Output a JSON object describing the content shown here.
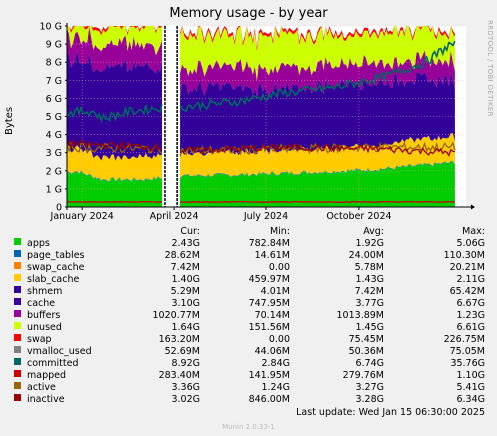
{
  "chart_data": {
    "type": "area",
    "title": "Memory usage - by year",
    "ylabel": "Bytes",
    "xlabel": "",
    "side_label": "RRDTOOL / TOBI OETIKER",
    "y_tick_labels": [
      "0",
      "1 G",
      "2 G",
      "3 G",
      "4 G",
      "5 G",
      "6 G",
      "7 G",
      "8 G",
      "9 G",
      "10 G"
    ],
    "ylim": [
      0,
      10
    ],
    "ylim_unit": "GB",
    "x_tick_labels": [
      "January 2024",
      "April 2024",
      "July 2024",
      "October 2024"
    ],
    "x_ticks": [
      0,
      91,
      182,
      274
    ],
    "xlim": [
      -15,
      380
    ],
    "xlim_unit": "days since 2024-01-01",
    "gap": [
      80,
      96
    ],
    "grid": true,
    "stacked_series": [
      {
        "name": "apps",
        "color": "#00cc00",
        "points": [
          [
            -15,
            1.9
          ],
          [
            -5,
            1.95
          ],
          [
            20,
            1.5
          ],
          [
            60,
            1.5
          ],
          [
            80,
            1.6
          ],
          [
            96,
            1.7
          ],
          [
            150,
            1.75
          ],
          [
            200,
            1.85
          ],
          [
            250,
            1.95
          ],
          [
            300,
            2.1
          ],
          [
            340,
            2.3
          ],
          [
            370,
            2.45
          ]
        ]
      },
      {
        "name": "page_tables",
        "color": "#0066b3",
        "points": [
          [
            -15,
            0.03
          ],
          [
            370,
            0.03
          ]
        ]
      },
      {
        "name": "swap_cache",
        "color": "#ff8000",
        "points": [
          [
            -15,
            0.01
          ],
          [
            370,
            0.01
          ]
        ]
      },
      {
        "name": "slab_cache",
        "color": "#ffcc00",
        "points": [
          [
            -15,
            1.3
          ],
          [
            20,
            1.2
          ],
          [
            80,
            1.3
          ],
          [
            96,
            1.2
          ],
          [
            200,
            1.25
          ],
          [
            300,
            1.35
          ],
          [
            370,
            1.4
          ]
        ]
      },
      {
        "name": "shmem",
        "color": "#330099",
        "points": [
          [
            -15,
            0.01
          ],
          [
            370,
            0.01
          ]
        ]
      },
      {
        "name": "cache",
        "color": "#330099",
        "points": [
          [
            -15,
            5.0
          ],
          [
            20,
            5.0
          ],
          [
            80,
            4.9
          ],
          [
            96,
            3.6
          ],
          [
            150,
            3.6
          ],
          [
            200,
            3.3
          ],
          [
            260,
            3.6
          ],
          [
            320,
            3.4
          ],
          [
            370,
            3.1
          ]
        ]
      },
      {
        "name": "buffers",
        "color": "#990099",
        "points": [
          [
            -15,
            1.3
          ],
          [
            80,
            1.2
          ],
          [
            96,
            1.1
          ],
          [
            200,
            1.15
          ],
          [
            300,
            1.1
          ],
          [
            370,
            1.0
          ]
        ]
      },
      {
        "name": "unused",
        "color": "#ccff00",
        "points": [
          [
            -15,
            0.85
          ],
          [
            20,
            1.0
          ],
          [
            80,
            1.2
          ],
          [
            96,
            1.85
          ],
          [
            150,
            1.7
          ],
          [
            200,
            1.9
          ],
          [
            260,
            1.55
          ],
          [
            320,
            1.7
          ],
          [
            370,
            1.63
          ]
        ]
      },
      {
        "name": "swap",
        "color": "#ff0000",
        "points": [
          [
            -15,
            0.16
          ],
          [
            370,
            0.16
          ]
        ]
      }
    ],
    "line_series": [
      {
        "name": "committed",
        "color": "#006666",
        "points": [
          [
            -15,
            5.2
          ],
          [
            10,
            5.3
          ],
          [
            20,
            4.9
          ],
          [
            50,
            5.3
          ],
          [
            80,
            5.5
          ],
          [
            96,
            5.5
          ],
          [
            150,
            5.8
          ],
          [
            200,
            6.3
          ],
          [
            250,
            6.6
          ],
          [
            300,
            7.2
          ],
          [
            340,
            8.0
          ],
          [
            365,
            9.0
          ],
          [
            370,
            8.9
          ]
        ]
      },
      {
        "name": "active",
        "color": "#996600",
        "points": [
          [
            -15,
            3.3
          ],
          [
            80,
            3.2
          ],
          [
            96,
            3.1
          ],
          [
            200,
            3.2
          ],
          [
            300,
            3.3
          ],
          [
            370,
            3.3
          ]
        ]
      },
      {
        "name": "inactive",
        "color": "#990000",
        "points": [
          [
            -15,
            3.5
          ],
          [
            80,
            3.3
          ],
          [
            96,
            3.1
          ],
          [
            200,
            3.3
          ],
          [
            300,
            3.2
          ],
          [
            370,
            3.0
          ]
        ]
      },
      {
        "name": "mapped",
        "color": "#cc0000",
        "points": [
          [
            -15,
            0.28
          ],
          [
            370,
            0.28
          ]
        ]
      }
    ]
  },
  "legend": {
    "headers": {
      "cur": "Cur:",
      "min": "Min:",
      "avg": "Avg:",
      "max": "Max:"
    },
    "rows": [
      {
        "name": "apps",
        "color": "#00cc00",
        "cur": "2.43G",
        "min": "782.84M",
        "avg": "1.92G",
        "max": "5.06G"
      },
      {
        "name": "page_tables",
        "color": "#0066b3",
        "cur": "28.62M",
        "min": "14.61M",
        "avg": "24.00M",
        "max": "110.30M"
      },
      {
        "name": "swap_cache",
        "color": "#ff8000",
        "cur": "7.42M",
        "min": "0.00",
        "avg": "5.78M",
        "max": "20.21M"
      },
      {
        "name": "slab_cache",
        "color": "#ffcc00",
        "cur": "1.40G",
        "min": "459.97M",
        "avg": "1.43G",
        "max": "2.11G"
      },
      {
        "name": "shmem",
        "color": "#330099",
        "cur": "5.29M",
        "min": "4.01M",
        "avg": "7.42M",
        "max": "65.42M"
      },
      {
        "name": "cache",
        "color": "#330099",
        "cur": "3.10G",
        "min": "747.95M",
        "avg": "3.77G",
        "max": "6.67G"
      },
      {
        "name": "buffers",
        "color": "#990099",
        "cur": "1020.77M",
        "min": "70.14M",
        "avg": "1013.89M",
        "max": "1.23G"
      },
      {
        "name": "unused",
        "color": "#ccff00",
        "cur": "1.64G",
        "min": "151.56M",
        "avg": "1.45G",
        "max": "6.61G"
      },
      {
        "name": "swap",
        "color": "#ff0000",
        "cur": "163.20M",
        "min": "0.00",
        "avg": "75.45M",
        "max": "226.75M"
      },
      {
        "name": "vmalloc_used",
        "color": "#808080",
        "cur": "52.69M",
        "min": "44.06M",
        "avg": "50.36M",
        "max": "75.05M"
      },
      {
        "name": "committed",
        "color": "#006666",
        "cur": "8.92G",
        "min": "2.84G",
        "avg": "6.74G",
        "max": "35.76G"
      },
      {
        "name": "mapped",
        "color": "#cc0000",
        "cur": "283.40M",
        "min": "141.95M",
        "avg": "279.76M",
        "max": "1.10G"
      },
      {
        "name": "active",
        "color": "#996600",
        "cur": "3.36G",
        "min": "1.24G",
        "avg": "3.27G",
        "max": "5.41G"
      },
      {
        "name": "inactive",
        "color": "#990000",
        "cur": "3.02G",
        "min": "846.00M",
        "avg": "3.28G",
        "max": "6.34G"
      }
    ]
  },
  "last_update": "Last update:  Wed Jan 15 06:30:00 2025",
  "footer": "Munin 2.0.33-1"
}
